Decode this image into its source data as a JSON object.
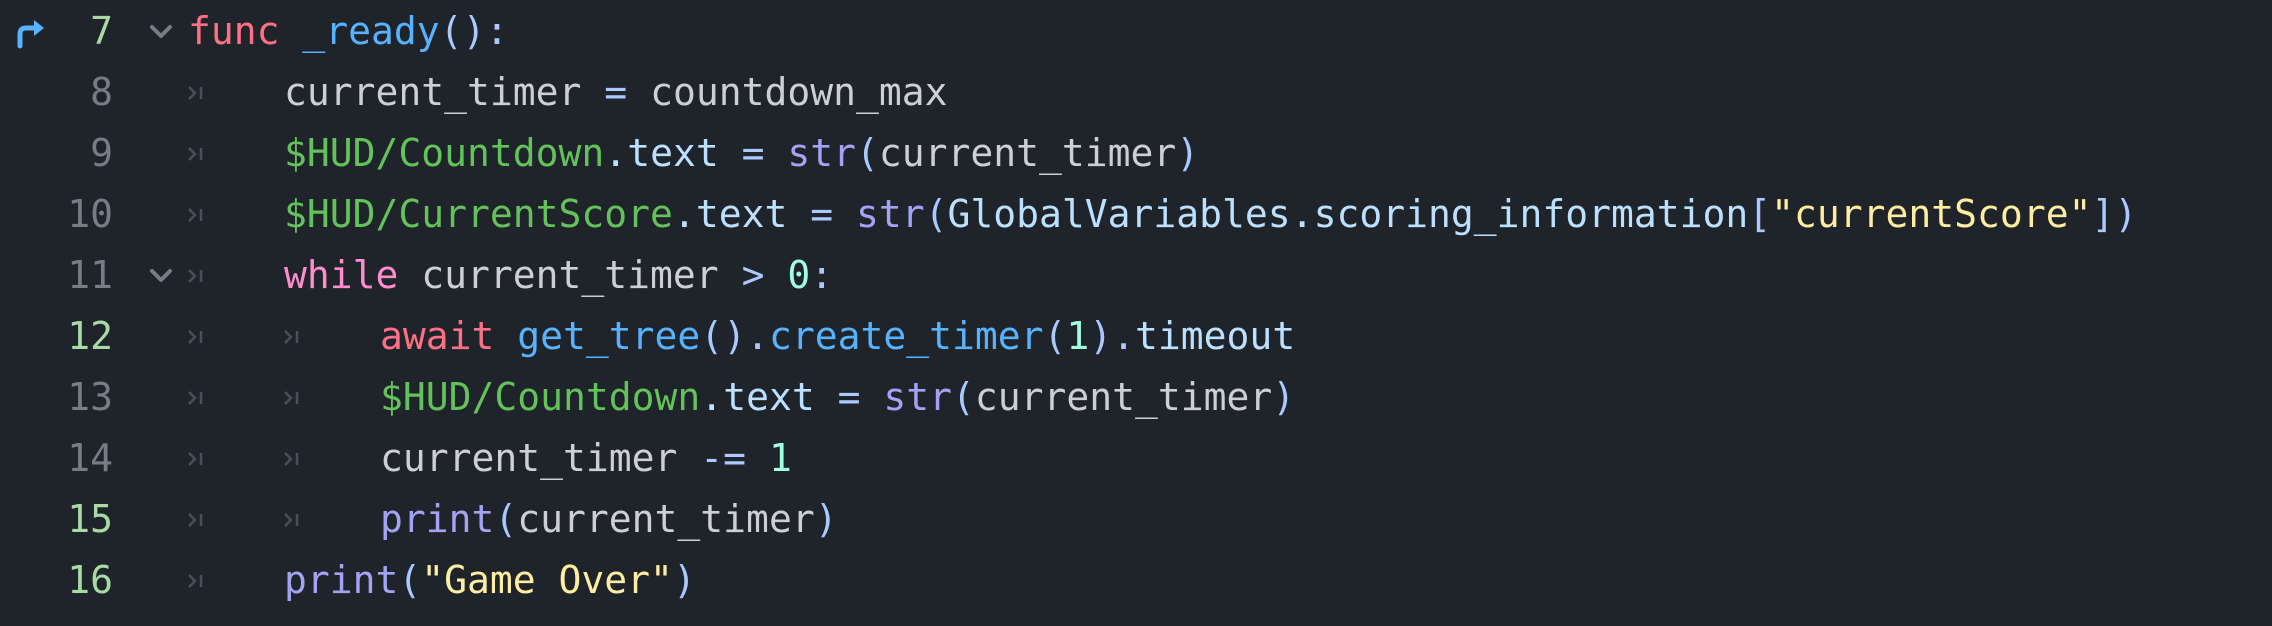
{
  "editor": {
    "colors": {
      "background": "#1f232a",
      "keyword": "#ff7085",
      "control_flow": "#ff8ccc",
      "function": "#57b3ff",
      "builtin": "#a3a3f5",
      "node_path": "#63c259",
      "member": "#bce0ff",
      "number": "#a1ffe0",
      "string": "#ffeda1",
      "line_number": "#787c85",
      "line_number_modified": "#a9d9a4",
      "gutter_marker": "#57b3ff"
    },
    "gutter_icons": {
      "line7": "override-arrow-icon"
    },
    "lines": [
      {
        "num": "7"
      },
      {
        "num": "8"
      },
      {
        "num": "9"
      },
      {
        "num": "10"
      },
      {
        "num": "11"
      },
      {
        "num": "12"
      },
      {
        "num": "13"
      },
      {
        "num": "14"
      },
      {
        "num": "15"
      },
      {
        "num": "16"
      }
    ],
    "tokens": {
      "l7": {
        "func": "func",
        "name": "_ready",
        "paren": "():"
      },
      "l8": {
        "a": "current_timer",
        "eq": " = ",
        "b": "countdown_max"
      },
      "l9": {
        "path": "$HUD/Countdown",
        "dot": ".",
        "member": "text",
        "eq": " = ",
        "fn": "str",
        "open": "(",
        "arg": "current_timer",
        "close": ")"
      },
      "l10": {
        "path": "$HUD/CurrentScore",
        "dot": ".",
        "member": "text",
        "eq": " = ",
        "fn": "str",
        "open": "(",
        "obj": "GlobalVariables",
        "dot2": ".",
        "member2": "scoring_information",
        "bopen": "[",
        "str": "\"currentScore\"",
        "bclose": "])"
      },
      "l11": {
        "kw": "while",
        "a": " current_timer ",
        "op": ">",
        "sp": " ",
        "num": "0",
        "colon": ":"
      },
      "l12": {
        "kw": "await",
        "sp": " ",
        "fn": "get_tree",
        "p1": "().",
        "fn2": "create_timer",
        "p2": "(",
        "num": "1",
        "p3": ").",
        "member": "timeout"
      },
      "l13": {
        "path": "$HUD/Countdown",
        "dot": ".",
        "member": "text",
        "eq": " = ",
        "fn": "str",
        "open": "(",
        "arg": "current_timer",
        "close": ")"
      },
      "l14": {
        "a": "current_timer ",
        "op": "-=",
        "sp": " ",
        "num": "1"
      },
      "l15": {
        "fn": "print",
        "open": "(",
        "arg": "current_timer",
        "close": ")"
      },
      "l16": {
        "fn": "print",
        "open": "(",
        "str": "\"Game Over\"",
        "close": ")"
      }
    }
  }
}
